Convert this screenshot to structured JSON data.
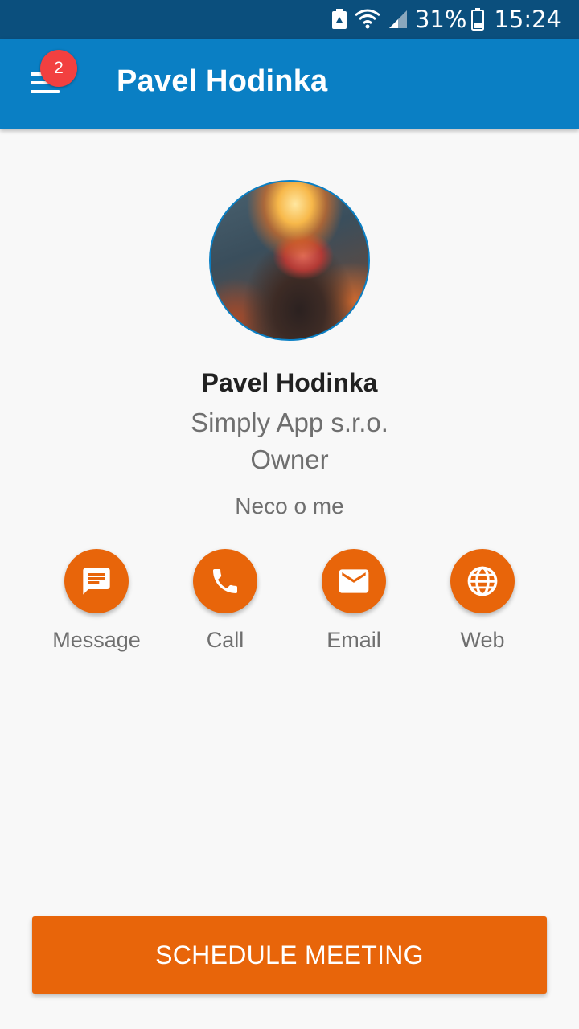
{
  "status_bar": {
    "battery_percent": "31%",
    "time": "15:24",
    "icons": [
      "recycle-notification-icon",
      "wifi-icon",
      "signal-icon",
      "battery-icon"
    ]
  },
  "app_bar": {
    "title": "Pavel Hodinka",
    "menu_icon": "hamburger-icon",
    "notification_count": "2",
    "color": "#0a7fc4"
  },
  "profile": {
    "name": "Pavel Hodinka",
    "company": "Simply App s.r.o.",
    "role": "Owner",
    "about": "Neco o me"
  },
  "actions": [
    {
      "label": "Message",
      "icon": "message-icon"
    },
    {
      "label": "Call",
      "icon": "phone-icon"
    },
    {
      "label": "Email",
      "icon": "email-icon"
    },
    {
      "label": "Web",
      "icon": "globe-icon"
    }
  ],
  "schedule_button": {
    "label": "SCHEDULE MEETING"
  },
  "colors": {
    "primary": "#0a7fc4",
    "status_bar": "#0b4f7d",
    "accent": "#e8650a",
    "badge": "#f24040"
  }
}
